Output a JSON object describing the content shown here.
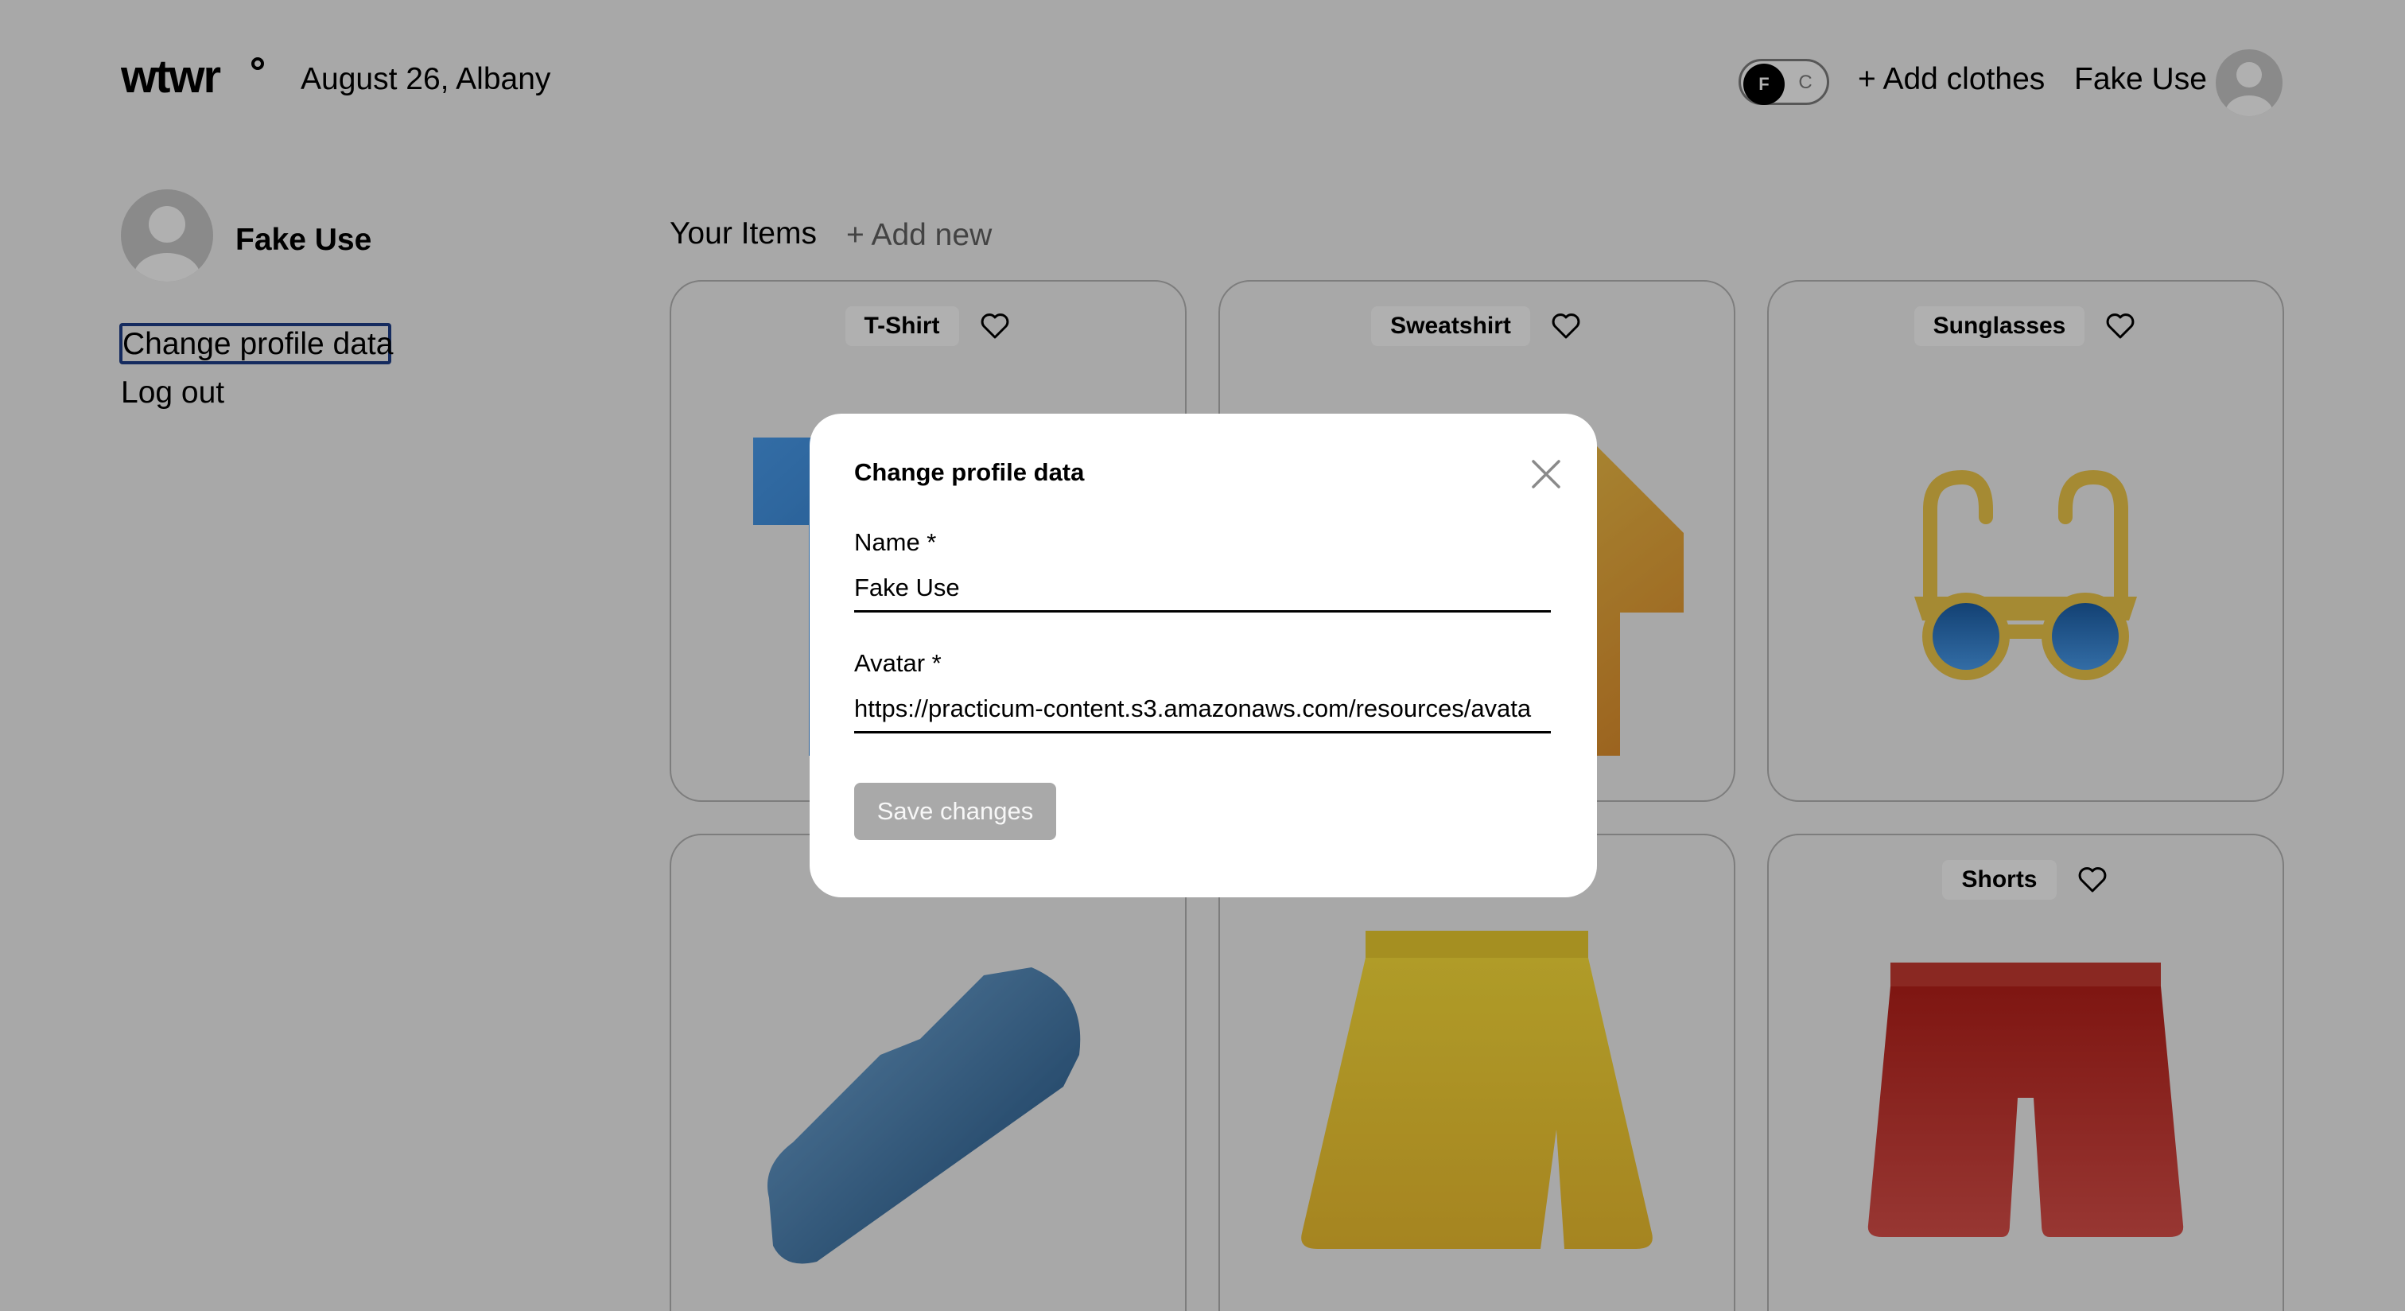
{
  "header": {
    "date_location": "August 26, Albany",
    "toggle": {
      "active": "F",
      "inactive": "C"
    },
    "add_clothes": "+ Add clothes",
    "username": "Fake Use"
  },
  "sidebar": {
    "username": "Fake Use",
    "change_profile": "Change profile data",
    "logout": "Log out"
  },
  "items": {
    "title": "Your Items",
    "add_new": "+ Add new",
    "cards": [
      {
        "label": "T-Shirt",
        "icon": "tshirt-icon"
      },
      {
        "label": "Sweatshirt",
        "icon": "sweatshirt-icon"
      },
      {
        "label": "Sunglasses",
        "icon": "sunglasses-icon"
      },
      {
        "label": "",
        "icon": "sneaker-icon"
      },
      {
        "label": "",
        "icon": "skirt-icon"
      },
      {
        "label": "Shorts",
        "icon": "shorts-icon"
      }
    ]
  },
  "modal": {
    "title": "Change profile data",
    "name_label": "Name *",
    "name_value": "Fake Use",
    "avatar_label": "Avatar *",
    "avatar_value": "https://practicum-content.s3.amazonaws.com/resources/avata",
    "save_label": "Save changes"
  },
  "colors": {
    "overlay": "#000000",
    "focus_outline": "#1f3f8a",
    "disabled_button": "#a9a9a9"
  }
}
